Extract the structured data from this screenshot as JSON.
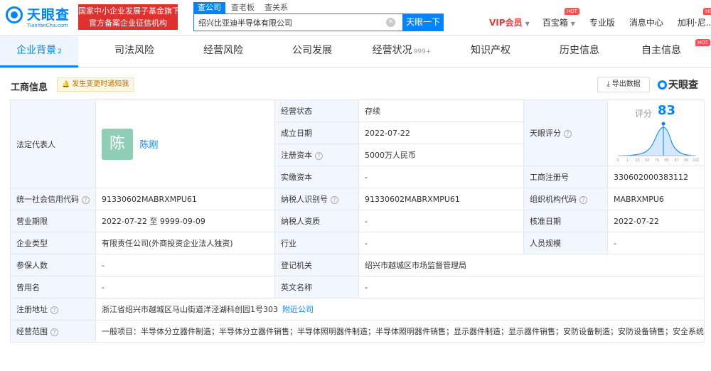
{
  "header": {
    "logo_name": "天眼查",
    "logo_sub": "TianYanCha.com",
    "banner_line1": "国家中小企业发展子基金旗下",
    "banner_line2": "官方备案企业征信机构",
    "search_tabs": [
      "查公司",
      "查老板",
      "查关系"
    ],
    "search_value": "绍兴比亚迪半导体有限公司",
    "search_button": "天眼一下",
    "nav": [
      "VIP会员",
      "百宝箱",
      "专业版",
      "消息中心",
      "加利·尼..."
    ],
    "hot_badge": "HOT"
  },
  "tabs": [
    {
      "label": "企业背景",
      "count": "2"
    },
    {
      "label": "司法风险",
      "count": ""
    },
    {
      "label": "经营风险",
      "count": ""
    },
    {
      "label": "公司发展",
      "count": ""
    },
    {
      "label": "经营状况",
      "count": "999+"
    },
    {
      "label": "知识产权",
      "count": ""
    },
    {
      "label": "历史信息",
      "count": ""
    },
    {
      "label": "自主信息",
      "count": ""
    }
  ],
  "section": {
    "title": "工商信息",
    "notify": "发生变更时通知我",
    "export": "导出数据",
    "brand": "天眼查"
  },
  "score": {
    "label": "评分",
    "value": "83",
    "ticks": [
      "0",
      "1",
      "25",
      "50",
      "75",
      "85",
      "97",
      "99",
      "100"
    ]
  },
  "info": {
    "legal_rep_label": "法定代表人",
    "legal_rep_avatar": "陈",
    "legal_rep_name": "陈刚",
    "status_label": "经营状态",
    "status_value": "存续",
    "established_label": "成立日期",
    "established_value": "2022-07-22",
    "reg_capital_label": "注册资本",
    "reg_capital_value": "5000万人民币",
    "paid_capital_label": "实缴资本",
    "paid_capital_value": "-",
    "tianyan_score_label": "天眼评分",
    "reg_no_label": "工商注册号",
    "reg_no_value": "330602000383112",
    "credit_code_label": "统一社会信用代码",
    "credit_code_value": "91330602MABRXMPU61",
    "taxpayer_id_label": "纳税人识别号",
    "taxpayer_id_value": "91330602MABRXMPU61",
    "org_code_label": "组织机构代码",
    "org_code_value": "MABRXMPU6",
    "term_label": "营业期限",
    "term_value": "2022-07-22 至 9999-09-09",
    "taxpayer_qual_label": "纳税人资质",
    "taxpayer_qual_value": "-",
    "approval_date_label": "核准日期",
    "approval_date_value": "2022-07-22",
    "company_type_label": "企业类型",
    "company_type_value": "有限责任公司(外商投资企业法人独资)",
    "industry_label": "行业",
    "industry_value": "-",
    "staff_size_label": "人员规模",
    "staff_size_value": "-",
    "insured_label": "参保人数",
    "insured_value": "-",
    "reg_authority_label": "登记机关",
    "reg_authority_value": "绍兴市越城区市场监督管理局",
    "former_name_label": "曾用名",
    "former_name_value": "-",
    "english_name_label": "英文名称",
    "english_name_value": "-",
    "address_label": "注册地址",
    "address_value": "浙江省绍兴市越城区马山街道洋泾湖科创园1号303",
    "address_link": "附近公司",
    "scope_label": "经营范围",
    "scope_value": "一般项目：半导体分立器件制造；半导体分立器件销售；半导体照明器件制造；半导体照明器件销售；显示器件制造；显示器件销售；安防设备制造；安防设备销售；安全系统监控服务；技术服务、技术开发、技术咨询、技术交流、技术转让、技术推广；合同能源管理；货物进出口；技术进出口(除依法须经批准的项目外，凭营业执照依法自主开展经营活动)。"
  }
}
